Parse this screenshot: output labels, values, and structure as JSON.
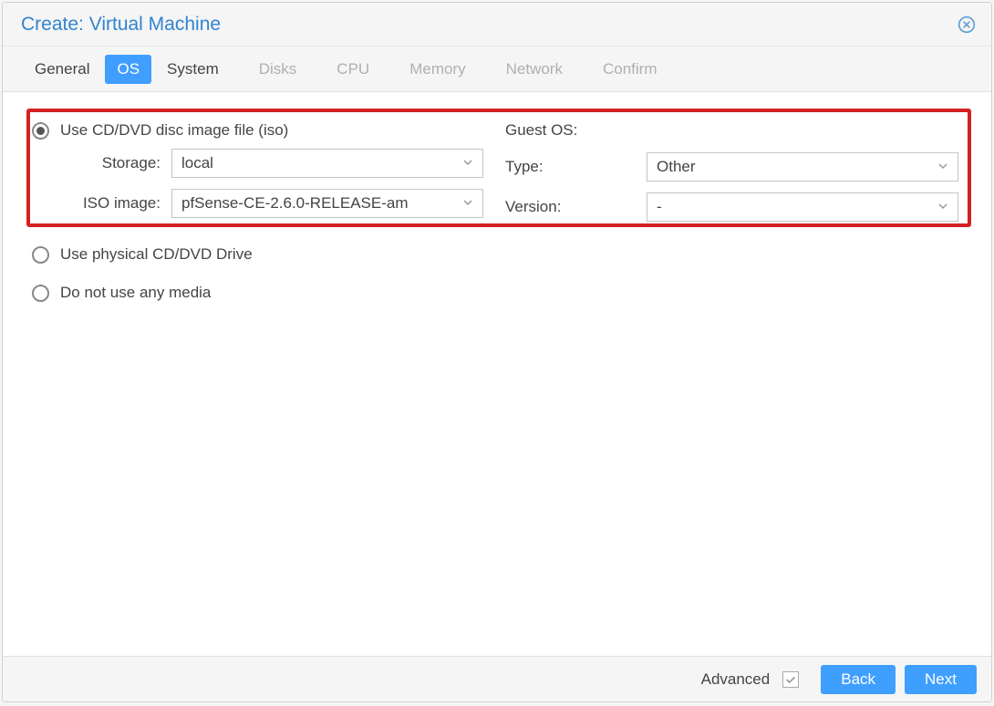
{
  "window": {
    "title": "Create: Virtual Machine"
  },
  "tabs": {
    "general": "General",
    "os": "OS",
    "system": "System",
    "disks": "Disks",
    "cpu": "CPU",
    "memory": "Memory",
    "network": "Network",
    "confirm": "Confirm"
  },
  "radios": {
    "use_iso": "Use CD/DVD disc image file (iso)",
    "use_phys": "Use physical CD/DVD Drive",
    "no_media": "Do not use any media"
  },
  "fields": {
    "storage_label": "Storage:",
    "storage_value": "local",
    "iso_label": "ISO image:",
    "iso_value": "pfSense-CE-2.6.0-RELEASE-am",
    "guest_os_header": "Guest OS:",
    "type_label": "Type:",
    "type_value": "Other",
    "version_label": "Version:",
    "version_value": "-"
  },
  "footer": {
    "advanced": "Advanced",
    "back": "Back",
    "next": "Next"
  }
}
